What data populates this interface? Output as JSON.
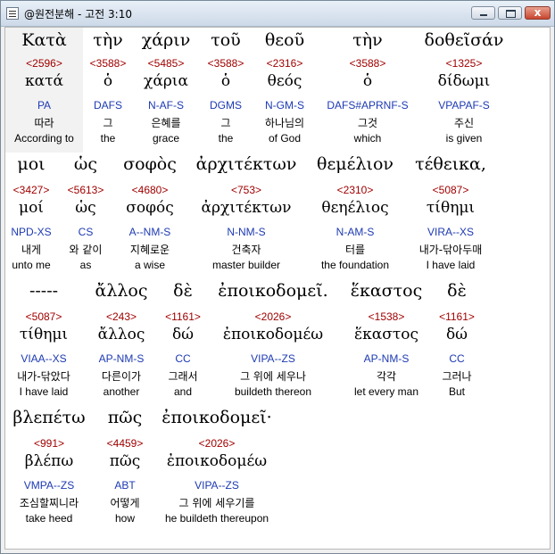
{
  "window": {
    "title": "@원전분해 - 고전 3:10",
    "close_glyph": "x"
  },
  "colors": {
    "strongs": "#a00000",
    "parsing": "#1d3ab2",
    "text": "#000000",
    "background": "#ffffff"
  },
  "rows": [
    {
      "words": [
        {
          "greek": "Κατὰ",
          "strongs": "<2596>",
          "lemma": "κατά",
          "parsing": "PA",
          "korean": "따라",
          "english": "According to",
          "selected": true
        },
        {
          "greek": "τὴν",
          "strongs": "<3588>",
          "lemma": "ὁ",
          "parsing": "DAFS",
          "korean": "그",
          "english": "the"
        },
        {
          "greek": "χάριν",
          "strongs": "<5485>",
          "lemma": "χάρια",
          "parsing": "N-AF-S",
          "korean": "은혜를",
          "english": "grace"
        },
        {
          "greek": "τοῦ",
          "strongs": "<3588>",
          "lemma": "ὁ",
          "parsing": "DGMS",
          "korean": "그",
          "english": "the"
        },
        {
          "greek": "θεοῦ",
          "strongs": "<2316>",
          "lemma": "θεός",
          "parsing": "N-GM-S",
          "korean": "하나님의",
          "english": "of God"
        },
        {
          "greek": "τὴν",
          "strongs": "<3588>",
          "lemma": "ὁ",
          "parsing": "DAFS#APRNF-S",
          "korean": "그것",
          "english": "which"
        },
        {
          "greek": "δοθεῖσάν",
          "strongs": "<1325>",
          "lemma": "δίδωμι",
          "parsing": "VPAPAF-S",
          "korean": "주신",
          "english": "is given"
        }
      ]
    },
    {
      "words": [
        {
          "greek": "μοι",
          "strongs": "<3427>",
          "lemma": "μοί",
          "parsing": "NPD-XS",
          "korean": "내게",
          "english": "unto me"
        },
        {
          "greek": "ὡς",
          "strongs": "<5613>",
          "lemma": "ὡς",
          "parsing": "CS",
          "korean": "와 같이",
          "english": "as"
        },
        {
          "greek": "σοφὸς",
          "strongs": "<4680>",
          "lemma": "σοφός",
          "parsing": "A--NM-S",
          "korean": "지혜로운",
          "english": "a wise"
        },
        {
          "greek": "ἀρχιτέκτων",
          "strongs": "<753>",
          "lemma": "ἀρχιτέκτων",
          "parsing": "N-NM-S",
          "korean": "건축자",
          "english": "master builder"
        },
        {
          "greek": "θεμέλιον",
          "strongs": "<2310>",
          "lemma": "θεηέλιος",
          "parsing": "N-AM-S",
          "korean": "터를",
          "english": "the foundation"
        },
        {
          "greek": "τέθεικα,",
          "strongs": "<5087>",
          "lemma": "τίθημι",
          "parsing": "VIRA--XS",
          "korean": "내가-닦아두매",
          "english": "I have laid"
        }
      ]
    },
    {
      "words": [
        {
          "greek": "-----",
          "strongs": "<5087>",
          "lemma": "τίθημι",
          "parsing": "VIAA--XS",
          "korean": "내가-닦았다",
          "english": "I have laid"
        },
        {
          "greek": "ἄλλος",
          "strongs": "<243>",
          "lemma": "ἄλλος",
          "parsing": "AP-NM-S",
          "korean": "다른이가",
          "english": "another"
        },
        {
          "greek": "δὲ",
          "strongs": "<1161>",
          "lemma": "δώ",
          "parsing": "CC",
          "korean": "그래서",
          "english": "and"
        },
        {
          "greek": "ἐποικοδομεῖ.",
          "strongs": "<2026>",
          "lemma": "ἐποικοδομέω",
          "parsing": "VIPA--ZS",
          "korean": "그 위에 세우나",
          "english": "buildeth thereon"
        },
        {
          "greek": "ἕκαστος",
          "strongs": "<1538>",
          "lemma": "ἕκαστος",
          "parsing": "AP-NM-S",
          "korean": "각각",
          "english": "let every man"
        },
        {
          "greek": "δὲ",
          "strongs": "<1161>",
          "lemma": "δώ",
          "parsing": "CC",
          "korean": "그러나",
          "english": "But"
        }
      ]
    },
    {
      "words": [
        {
          "greek": "βλεπέτω",
          "strongs": "<991>",
          "lemma": "βλέπω",
          "parsing": "VMPA--ZS",
          "korean": "조심할찌니라",
          "english": "take heed"
        },
        {
          "greek": "πῶς",
          "strongs": "<4459>",
          "lemma": "πῶς",
          "parsing": "ABT",
          "korean": "어떻게",
          "english": "how"
        },
        {
          "greek": "ἐποικοδομεῖ·",
          "strongs": "<2026>",
          "lemma": "ἐποικοδομέω",
          "parsing": "VIPA--ZS",
          "korean": "그 위에 세우기를",
          "english": "he buildeth thereupon"
        }
      ]
    }
  ]
}
